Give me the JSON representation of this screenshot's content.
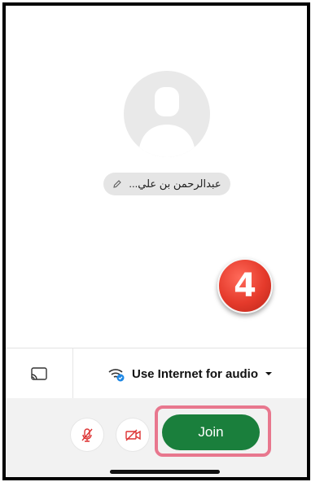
{
  "participant": {
    "display_name": "عبدالرحمن بن علي..."
  },
  "step_badge": {
    "number": "4",
    "color": "#e53a2b"
  },
  "audio": {
    "option_label": "Use Internet for audio",
    "icons": [
      "cast-icon",
      "wifi-icon",
      "chevron-down-icon"
    ]
  },
  "controls": {
    "mic_icon": "mic-off-icon",
    "camera_icon": "camera-off-icon",
    "join_label": "Join",
    "join_color": "#1a7f3c",
    "highlight_color": "#e8778e"
  }
}
